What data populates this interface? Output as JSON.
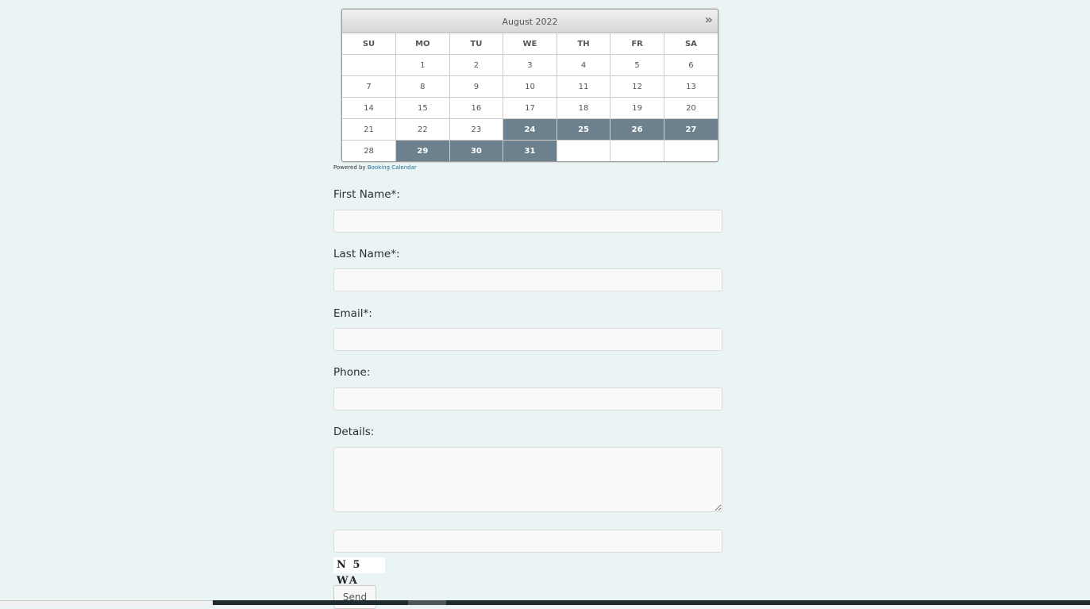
{
  "calendar": {
    "month_title": "August 2022",
    "next_icon": "double-chevron-right",
    "weekdays": [
      "SU",
      "MO",
      "TU",
      "WE",
      "TH",
      "FR",
      "SA"
    ],
    "weeks": [
      [
        "",
        "1",
        "2",
        "3",
        "4",
        "5",
        "6"
      ],
      [
        "7",
        "8",
        "9",
        "10",
        "11",
        "12",
        "13"
      ],
      [
        "14",
        "15",
        "16",
        "17",
        "18",
        "19",
        "20"
      ],
      [
        "21",
        "22",
        "23",
        "24",
        "25",
        "26",
        "27"
      ],
      [
        "28",
        "29",
        "30",
        "31",
        "",
        "",
        ""
      ]
    ],
    "booked_days": [
      "24",
      "25",
      "26",
      "27",
      "29",
      "30",
      "31"
    ],
    "booked_color": "#6d808e"
  },
  "powered": {
    "prefix": "Powered by",
    "link_text": "Booking Calendar"
  },
  "form": {
    "first_name_label": "First Name*:",
    "last_name_label": "Last Name*:",
    "email_label": "Email*:",
    "phone_label": "Phone:",
    "details_label": "Details:",
    "captcha_text": "N 5 WA",
    "send_label": "Send"
  }
}
